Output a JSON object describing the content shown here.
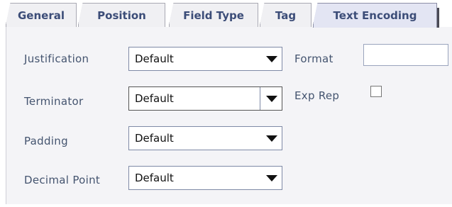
{
  "tabs": [
    {
      "label": "General"
    },
    {
      "label": "Position"
    },
    {
      "label": "Field Type"
    },
    {
      "label": "Tag"
    },
    {
      "label": "Text Encoding",
      "active": true
    }
  ],
  "form": {
    "justification": {
      "label": "Justification",
      "value": "Default"
    },
    "terminator": {
      "label": "Terminator",
      "value": "Default"
    },
    "padding": {
      "label": "Padding",
      "value": "Default"
    },
    "decimal_point": {
      "label": "Decimal Point",
      "value": "Default"
    },
    "format": {
      "label": "Format",
      "value": ""
    },
    "exp_rep": {
      "label": "Exp Rep",
      "checked": false
    }
  },
  "colors": {
    "tab_text": "#3c4d78",
    "label_text": "#44546f",
    "panel_bg": "#f4f4f7",
    "active_tab_bg": "#e3e5f3"
  }
}
